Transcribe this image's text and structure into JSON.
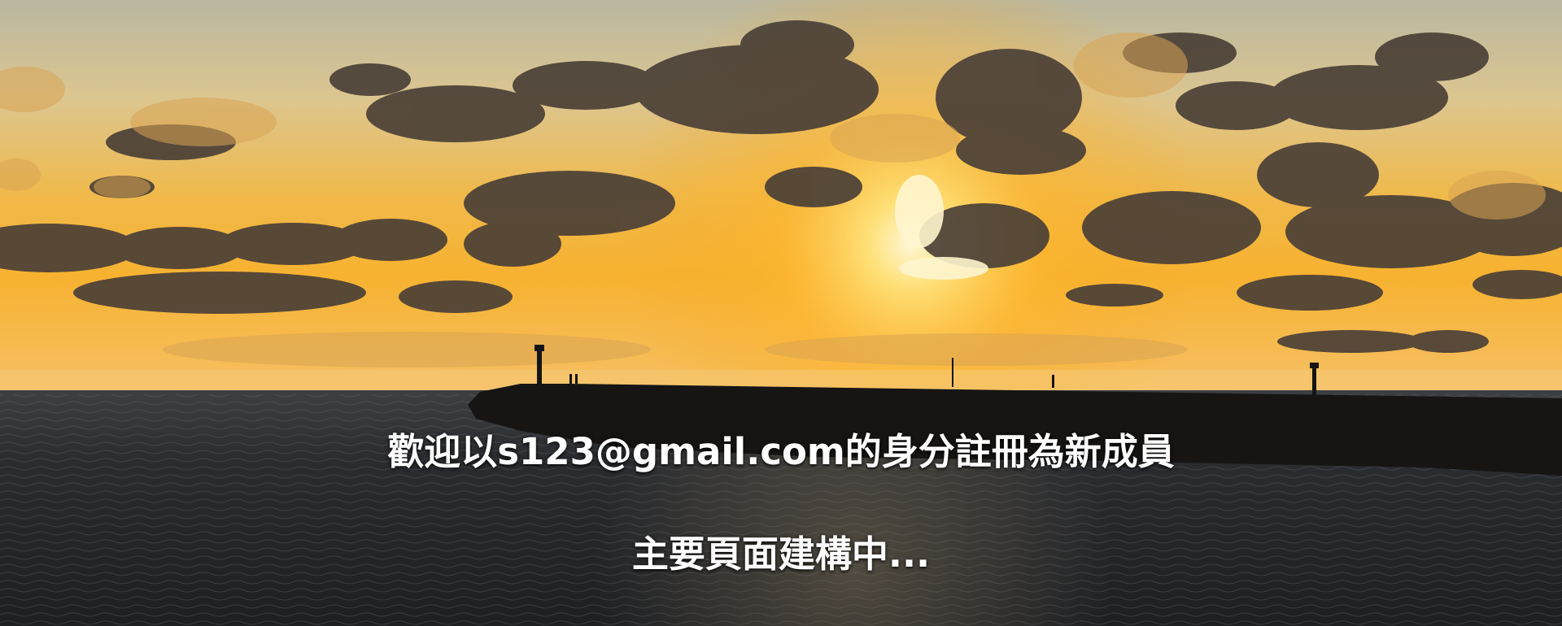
{
  "page": {
    "welcome_text": "歡迎以s123@gmail.com的身分註冊為新成員",
    "status_text": "主要頁面建構中..."
  },
  "background": {
    "scene": "sunset over sea with breakwater pier",
    "colors": {
      "sky_top": "#c9c2a0",
      "sky_glow": "#f7b42c",
      "sun": "#fff3c4",
      "cloud": "#4a3f35",
      "sea": "#2b2d30",
      "pier": "#151412"
    }
  }
}
